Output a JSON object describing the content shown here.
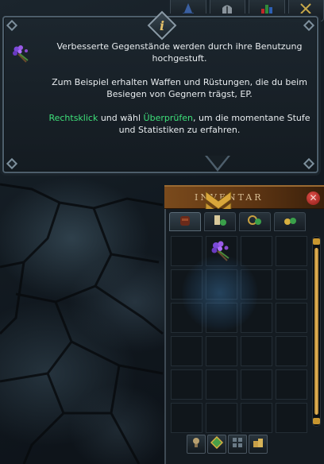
{
  "tooltip": {
    "info_glyph": "i",
    "item_icon": "flower-bouquet-icon",
    "line1": "Verbesserte Gegenstände werden durch ihre Benutzung hochgestuft.",
    "line2": "Zum Beispiel erhalten Waffen und Rüstungen, die du beim Besiegen von Gegnern trägst, EP.",
    "line3_part1": "Rechtsklick",
    "line3_part2": " und wähl ",
    "line3_part3": "Überprüfen",
    "line3_part4": ", um die momentane Stufe und Statistiken zu erfahren.",
    "highlight_color": "#3ee07a"
  },
  "top_tabs": [
    {
      "icon": "wizard-hat-icon"
    },
    {
      "icon": "helmet-icon"
    },
    {
      "icon": "stats-chart-icon"
    },
    {
      "icon": "crossed-swords-icon"
    }
  ],
  "inventory": {
    "title": "INVENTAR",
    "close_glyph": "✕",
    "tabs": [
      {
        "icon": "backpack-icon"
      },
      {
        "icon": "scroll-potion-icon"
      },
      {
        "icon": "gear-potion-icon"
      },
      {
        "icon": "gold-potion-icon"
      }
    ],
    "slot_count": 24,
    "filled_slot_index": 1,
    "filled_item_icon": "flower-bouquet-icon",
    "bottom_buttons": [
      {
        "icon": "trophy-icon"
      },
      {
        "icon": "gem-icon"
      },
      {
        "icon": "grid-icon"
      },
      {
        "icon": "coins-icon"
      }
    ]
  }
}
